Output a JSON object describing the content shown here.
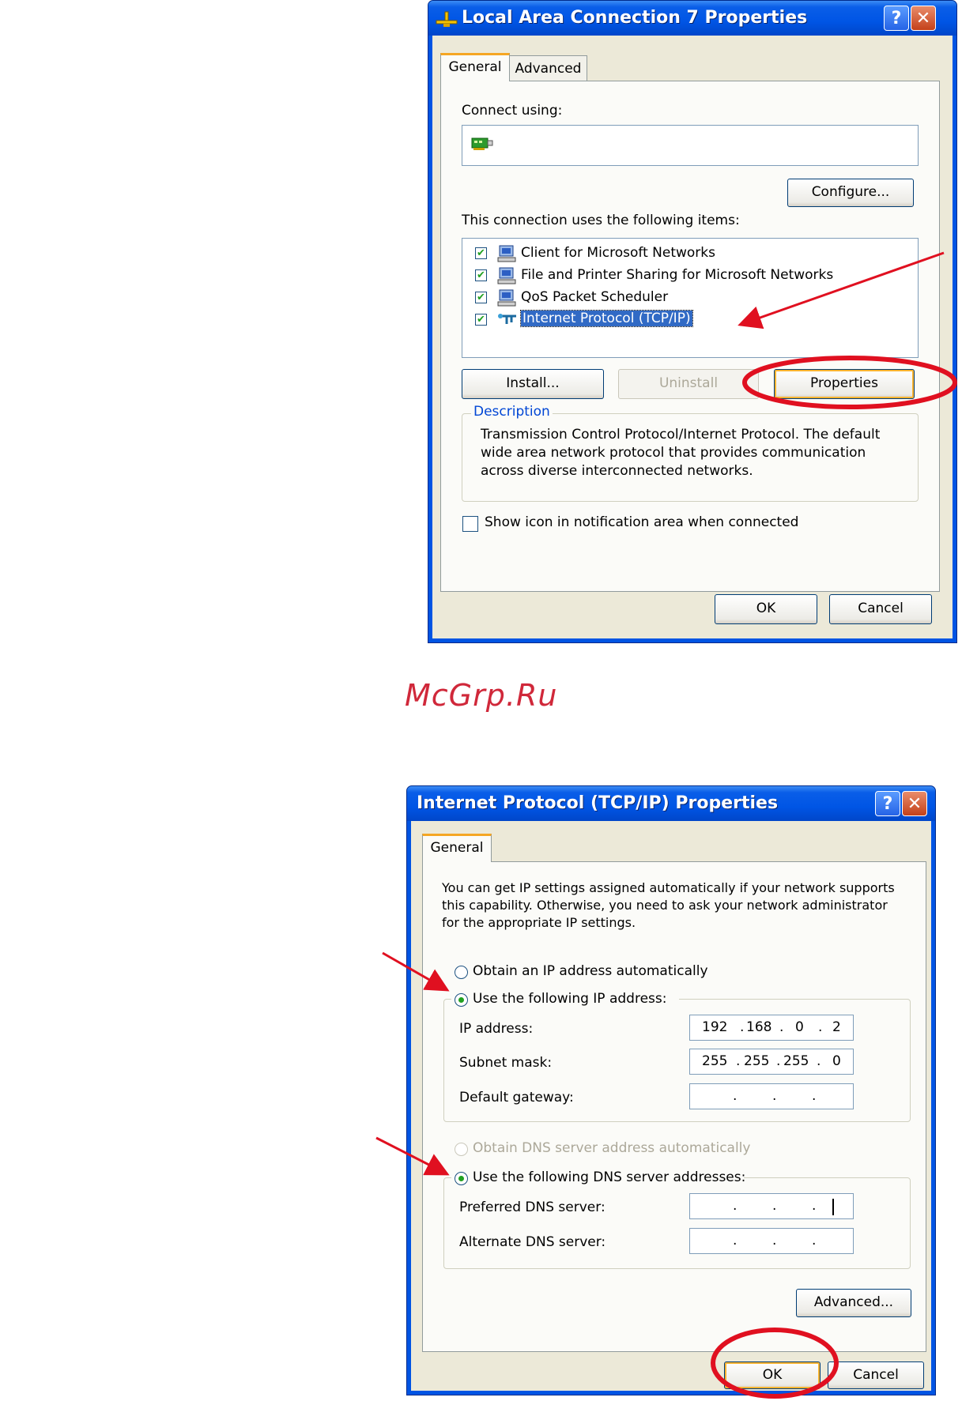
{
  "dialog1": {
    "title": "Local Area Connection 7 Properties",
    "help_glyph": "?",
    "close_glyph": "✕",
    "tabs": [
      {
        "label": "General"
      },
      {
        "label": "Advanced"
      }
    ],
    "connect_using_label": "Connect using:",
    "adapter_value": "",
    "configure_label": "Configure...",
    "items_label": "This connection uses the following items:",
    "items": [
      {
        "label": "Client for Microsoft Networks",
        "checked": true,
        "selected": false
      },
      {
        "label": "File and Printer Sharing for Microsoft Networks",
        "checked": true,
        "selected": false
      },
      {
        "label": "QoS Packet Scheduler",
        "checked": true,
        "selected": false
      },
      {
        "label": "Internet Protocol (TCP/IP)",
        "checked": true,
        "selected": true
      }
    ],
    "install_label": "Install...",
    "uninstall_label": "Uninstall",
    "properties_label": "Properties",
    "description_title": "Description",
    "description_text": "Transmission Control Protocol/Internet Protocol. The default wide area network protocol that provides communication across diverse interconnected networks.",
    "show_icon_label": "Show icon in notification area when connected",
    "show_icon_checked": false,
    "ok_label": "OK",
    "cancel_label": "Cancel"
  },
  "watermark": "McGrp.Ru",
  "dialog2": {
    "title": "Internet Protocol (TCP/IP) Properties",
    "help_glyph": "?",
    "close_glyph": "✕",
    "tabs": [
      {
        "label": "General"
      }
    ],
    "intro_text": "You can get IP settings assigned automatically if your network supports this capability. Otherwise, you need to ask your network administrator for the appropriate IP settings.",
    "obtain_ip_label": "Obtain an IP address automatically",
    "use_ip_label": "Use the following IP address:",
    "ip_address_label": "IP address:",
    "ip_address_value": [
      "192",
      "168",
      "0",
      "2"
    ],
    "subnet_label": "Subnet mask:",
    "subnet_value": [
      "255",
      "255",
      "255",
      "0"
    ],
    "gateway_label": "Default gateway:",
    "gateway_value": [
      "",
      "",
      "",
      ""
    ],
    "obtain_dns_label": "Obtain DNS server address automatically",
    "use_dns_label": "Use the following DNS server addresses:",
    "preferred_dns_label": "Preferred DNS server:",
    "preferred_dns_value": [
      "",
      "",
      "",
      ""
    ],
    "alternate_dns_label": "Alternate DNS server:",
    "alternate_dns_value": [
      "",
      "",
      "",
      ""
    ],
    "advanced_label": "Advanced...",
    "ok_label": "OK",
    "cancel_label": "Cancel"
  },
  "annotations": {
    "arrow_color": "#e01020",
    "circle_color": "#e01020"
  }
}
